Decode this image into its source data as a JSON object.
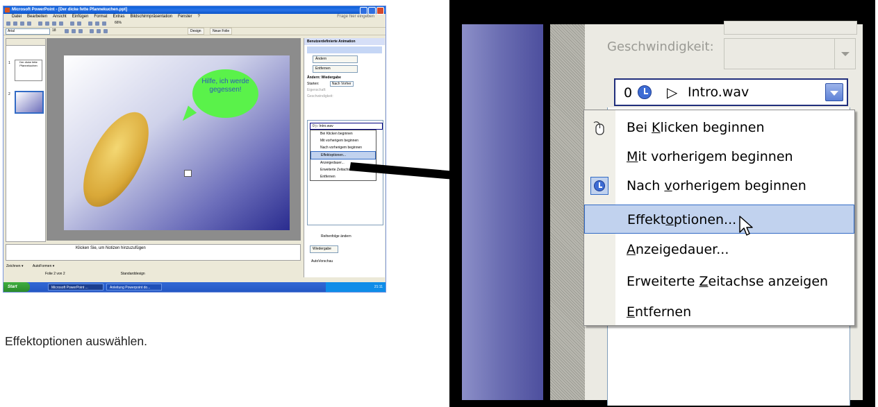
{
  "left_screenshot": {
    "window_title": "Microsoft PowerPoint - [Der dicke fette Pfannekuchen.ppt]",
    "menu": [
      "Datei",
      "Bearbeiten",
      "Ansicht",
      "Einfügen",
      "Format",
      "Extras",
      "Bildschirmpräsentation",
      "Fenster",
      "?"
    ],
    "help_placeholder": "Frage hier eingeben",
    "font_name": "Arial",
    "font_size": "18",
    "zoom": "66%",
    "design_button": "Design",
    "new_slide_button": "Neue Folie",
    "thumb1_text": "Der dicke fette Pfannekuchen",
    "thumb1_num": "1",
    "thumb2_num": "2",
    "speech_bubble": "Hilfe, ich werde gegessen!",
    "notes_placeholder": "Klicken Sie, um Notizen hinzuzufügen",
    "draw_label": "Zeichnen ▾",
    "autoshapes_label": "AutoFormen ▾",
    "status_slide": "Folie 2 von 2",
    "status_design": "Standarddesign",
    "task_pane_title": "Benutzerdefinierte Animation",
    "change_button": "Ändern",
    "remove_button": "Entfernen",
    "section_title": "Ändern: Wiedergabe",
    "start_label": "Starten:",
    "start_value": "Nach Vorher",
    "property_label": "Eigenschaft:",
    "speed_label": "Geschwindigkeit:",
    "mini_item": "0  ▷ Intro.wav",
    "mini_menu": [
      "Bei Klicken beginnen",
      "Mit vorherigem beginnen",
      "Nach vorherigem beginnen",
      "Effektoptionen...",
      "Anzeigedauer...",
      "Erweiterte Zeitachse anzeigen",
      "Entfernen"
    ],
    "reorder_label": "Reihenfolge ändern",
    "play_button": "Wiedergabe",
    "autopreview_label": "AutoVorschau",
    "taskbar_start": "Start",
    "taskbar_task1": "Microsoft PowerPoint ...",
    "taskbar_task2": "Anleitung Powerpoint do...",
    "clock": "21:11"
  },
  "caption": "Effektoptionen auswählen.",
  "zoom_panel": {
    "speed_label": "Geschwindigkeit:",
    "selected_item": {
      "order": "0",
      "play_symbol": "▷",
      "file": "Intro.wav"
    },
    "menu_items": [
      {
        "id": "click-start",
        "pre": "Bei ",
        "key": "K",
        "post": "licken beginnen",
        "icon": "mouse-icon",
        "checked": false,
        "highlighted": false
      },
      {
        "id": "with-previous",
        "pre": "",
        "key": "M",
        "post": "it vorherigem beginnen",
        "icon": "",
        "checked": false,
        "highlighted": false
      },
      {
        "id": "after-previous",
        "pre": "Nach ",
        "key": "v",
        "post": "orherigem beginnen",
        "icon": "clock-icon",
        "checked": true,
        "highlighted": false
      },
      {
        "id": "effect-options",
        "pre": "Effekt",
        "key": "o",
        "post": "ptionen...",
        "icon": "",
        "checked": false,
        "highlighted": true
      },
      {
        "id": "timing",
        "pre": "",
        "key": "A",
        "post": "nzeigedauer...",
        "icon": "",
        "checked": false,
        "highlighted": false
      },
      {
        "id": "advanced-timeline",
        "pre": "Erweiterte ",
        "key": "Z",
        "post": "eitachse anzeigen",
        "icon": "",
        "checked": false,
        "highlighted": false
      },
      {
        "id": "remove",
        "pre": "",
        "key": "E",
        "post": "ntfernen",
        "icon": "",
        "checked": false,
        "highlighted": false
      }
    ]
  },
  "colors": {
    "highlight": "#c1d2ee",
    "highlight_border": "#316ac5",
    "xp_blue": "#0a5fd8",
    "speech_green": "#5af24a",
    "speech_text": "#2e57b8"
  }
}
